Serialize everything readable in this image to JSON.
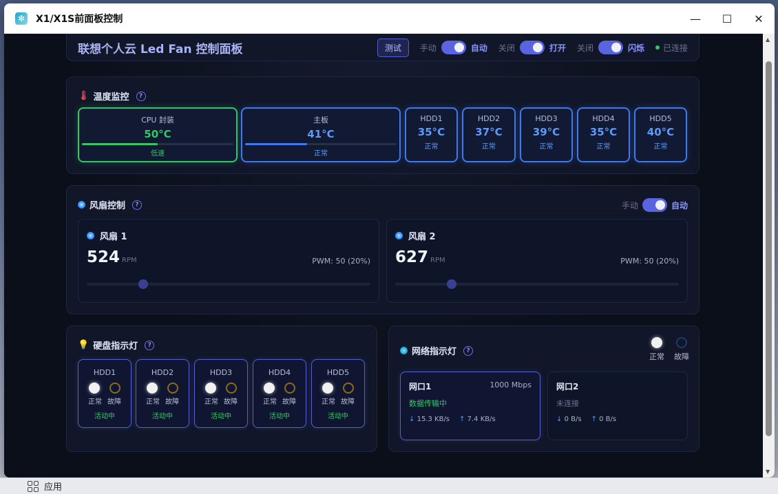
{
  "window": {
    "title": "X1/X1S前面板控制",
    "controls": {
      "minimize": "—",
      "maximize": "☐",
      "close": "✕"
    }
  },
  "header": {
    "title": "联想个人云 Led Fan 控制面板",
    "test_button": "测试",
    "mode_off": "手动",
    "mode_on": "自动",
    "led_off": "关闭",
    "led_on": "打开",
    "blink_off": "关闭",
    "blink_on": "闪烁",
    "status": "已连接"
  },
  "temperature": {
    "title": "温度监控",
    "items": [
      {
        "label": "CPU 封装",
        "value": "50°C",
        "status": "低速",
        "bar": 0.5
      },
      {
        "label": "主板",
        "value": "41°C",
        "status": "正常",
        "bar": 0.41
      },
      {
        "label": "HDD1",
        "value": "35°C",
        "status": "正常"
      },
      {
        "label": "HDD2",
        "value": "37°C",
        "status": "正常"
      },
      {
        "label": "HDD3",
        "value": "39°C",
        "status": "正常"
      },
      {
        "label": "HDD4",
        "value": "35°C",
        "status": "正常"
      },
      {
        "label": "HDD5",
        "value": "40°C",
        "status": "正常"
      }
    ]
  },
  "fan_control": {
    "title": "风扇控制",
    "mode_off": "手动",
    "mode_on": "自动",
    "fans": [
      {
        "name": "风扇 1",
        "rpm": "524",
        "unit": "RPM",
        "pwm": "PWM: 50 (20%)",
        "level": 0.2
      },
      {
        "name": "风扇 2",
        "rpm": "627",
        "unit": "RPM",
        "pwm": "PWM: 50 (20%)",
        "level": 0.2
      }
    ]
  },
  "disk_leds": {
    "title": "硬盘指示灯",
    "normal": "正常",
    "fault": "故障",
    "disks": [
      {
        "name": "HDD1",
        "status": "活动中"
      },
      {
        "name": "HDD2",
        "status": "活动中"
      },
      {
        "name": "HDD3",
        "status": "活动中"
      },
      {
        "name": "HDD4",
        "status": "活动中"
      },
      {
        "name": "HDD5",
        "status": "活动中"
      }
    ]
  },
  "network_leds": {
    "title": "网络指示灯",
    "normal": "正常",
    "fault": "故障",
    "ports": [
      {
        "name": "网口1",
        "speed": "1000 Mbps",
        "status": "数据传输中",
        "down": "15.3 KB/s",
        "up": "7.4 KB/s"
      },
      {
        "name": "网口2",
        "speed": "",
        "status": "未连接",
        "down": "0 B/s",
        "up": "0 B/s"
      }
    ]
  },
  "taskbar": {
    "apps_label": "应用"
  },
  "colors": {
    "accent": "#5a63e0",
    "ok": "#33c865",
    "info": "#5a9bff"
  }
}
